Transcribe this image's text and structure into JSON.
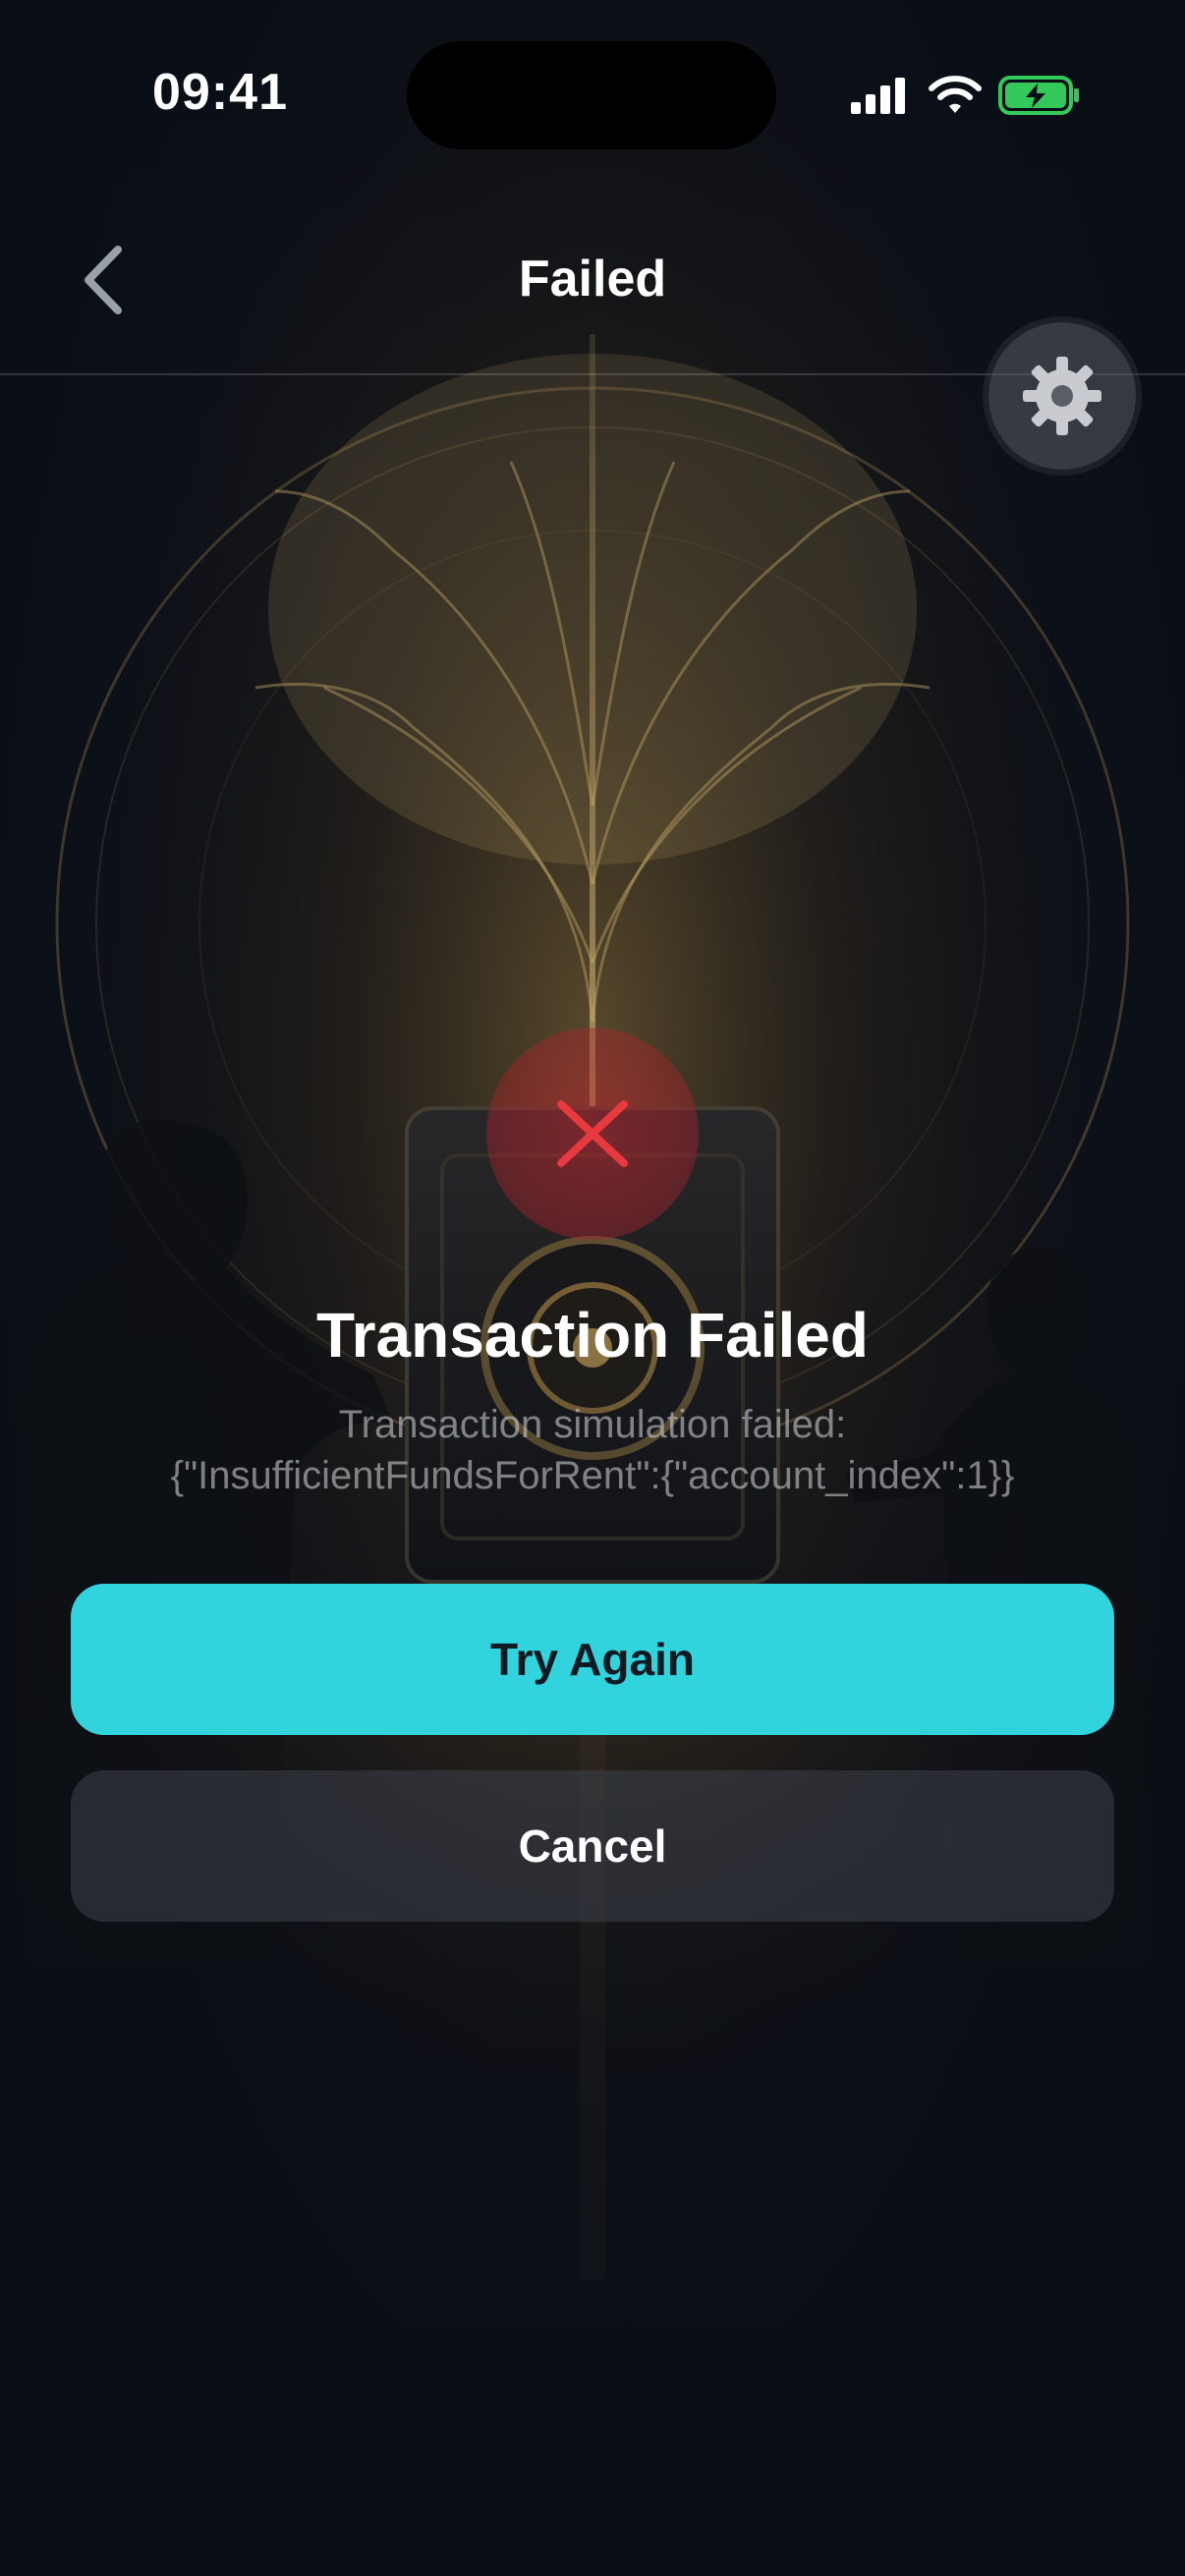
{
  "status_bar": {
    "time": "09:41",
    "icons": [
      "signal-icon",
      "wifi-icon",
      "battery-charging-icon"
    ]
  },
  "nav": {
    "title": "Failed",
    "back_icon": "chevron-left-icon",
    "settings_icon": "gear-icon"
  },
  "error": {
    "icon": "x-mark-icon",
    "title": "Transaction Failed",
    "message_line1": "Transaction simulation failed:",
    "message_line2": "{\"InsufficientFundsForRent\":{\"account_index\":1}}"
  },
  "actions": {
    "primary_label": "Try Again",
    "secondary_label": "Cancel"
  },
  "colors": {
    "accent": "#31d3dc",
    "error": "#e8393f",
    "battery": "#34c759"
  }
}
